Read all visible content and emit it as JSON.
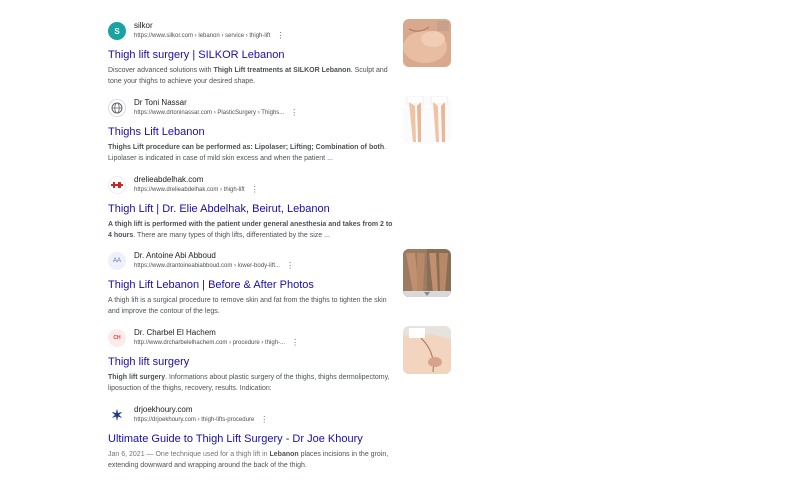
{
  "results": [
    {
      "site_name": "silkor",
      "url": "https://www.silkor.com › lebanon › service › thigh-lift",
      "title": "Thigh lift surgery | SILKOR Lebanon",
      "snippet_parts": [
        {
          "text": "Discover advanced solutions with ",
          "bold": false
        },
        {
          "text": "Thigh Lift treatments at SILKOR Lebanon",
          "bold": true
        },
        {
          "text": ". Sculpt and tone your thighs to achieve your desired shape.",
          "bold": false
        }
      ],
      "favicon": "silkor-s-logo",
      "favicon_text": "S",
      "favicon_color": "#1aa3a3",
      "has_thumbnail": true,
      "thumbnail": "thigh-skin-photo"
    },
    {
      "site_name": "Dr Toni Nassar",
      "url": "https://www.drtoninassar.com › PlasticSurgery › Thighs...",
      "title": "Thighs Lift Lebanon",
      "snippet_parts": [
        {
          "text": "Thighs Lift procedure can be performed as: Lipolaser; Lifting; Combination of both",
          "bold": true
        },
        {
          "text": ". Lipolaser is indicated in case of mild skin excess and when the patient ...",
          "bold": false
        }
      ],
      "favicon": "generic-globe-icon",
      "favicon_text": "",
      "favicon_color": "#5f6368",
      "has_thumbnail": true,
      "thumbnail": "legs-before-after-photo"
    },
    {
      "site_name": "drelieabdelhak.com",
      "url": "https://www.drelieabdelhak.com › thigh-lift",
      "title": "Thigh Lift | Dr. Elie Abdelhak, Beirut, Lebanon",
      "snippet_parts": [
        {
          "text": "A thigh lift is performed with the patient under general anesthesia and takes from 2 to 4 hours",
          "bold": true
        },
        {
          "text": ". There are many types of thigh lifts, differentiated by the size ...",
          "bold": false
        }
      ],
      "favicon": "elie-abdelhak-logo",
      "favicon_text": "",
      "favicon_color": "#c62828",
      "has_thumbnail": false,
      "thumbnail": ""
    },
    {
      "site_name": "Dr. Antoine Abi Abboud",
      "url": "https://www.drantoineabiabboud.com › lower-body-lift...",
      "title": "Thigh Lift Lebanon | Before & After Photos",
      "snippet_parts": [
        {
          "text": "A thigh lift is a surgical procedure to remove skin and fat from the thighs to tighten the skin and improve the contour of the legs.",
          "bold": false
        }
      ],
      "favicon": "aa-monogram-logo",
      "favicon_text": "AA",
      "favicon_color": "#5c6bc0",
      "has_thumbnail": true,
      "thumbnail": "thighs-before-after-photo"
    },
    {
      "site_name": "Dr. Charbel El Hachem",
      "url": "http://www.drcharbelelhachem.com › procedure › thigh-...",
      "title": "Thigh lift surgery",
      "snippet_parts": [
        {
          "text": "Thigh lift surgery",
          "bold": true
        },
        {
          "text": ". Informations about plastic surgery of the thighs, thighs dermolipectomy, liposuction of the thighs, recovery, results. Indication:",
          "bold": false
        }
      ],
      "favicon": "ch-logo",
      "favicon_text": "CH",
      "favicon_color": "#e53935",
      "has_thumbnail": true,
      "thumbnail": "thigh-marking-photo"
    },
    {
      "site_name": "drjoekhoury.com",
      "url": "https://drjoekhoury.com › thigh-lifts-procedure",
      "title": "Ultimate Guide to Thigh Lift Surgery - Dr Joe Khoury",
      "snippet_parts": [
        {
          "text": "Jan 6, 2021 — One technique used for a thigh lift in ",
          "bold": false,
          "muted": true
        },
        {
          "text": "Lebanon",
          "bold": true
        },
        {
          "text": " places incisions in the groin, extending downward and wrapping around the back of the thigh.",
          "bold": false
        }
      ],
      "favicon": "joe-khoury-star-logo",
      "favicon_text": "✶",
      "favicon_color": "#1e3a8a",
      "has_thumbnail": false,
      "thumbnail": ""
    }
  ],
  "more_options_glyph": "⋮",
  "colors": {
    "title_link": "#1a0dab",
    "url_text": "#4d5156",
    "snippet_text": "#4d5156"
  }
}
